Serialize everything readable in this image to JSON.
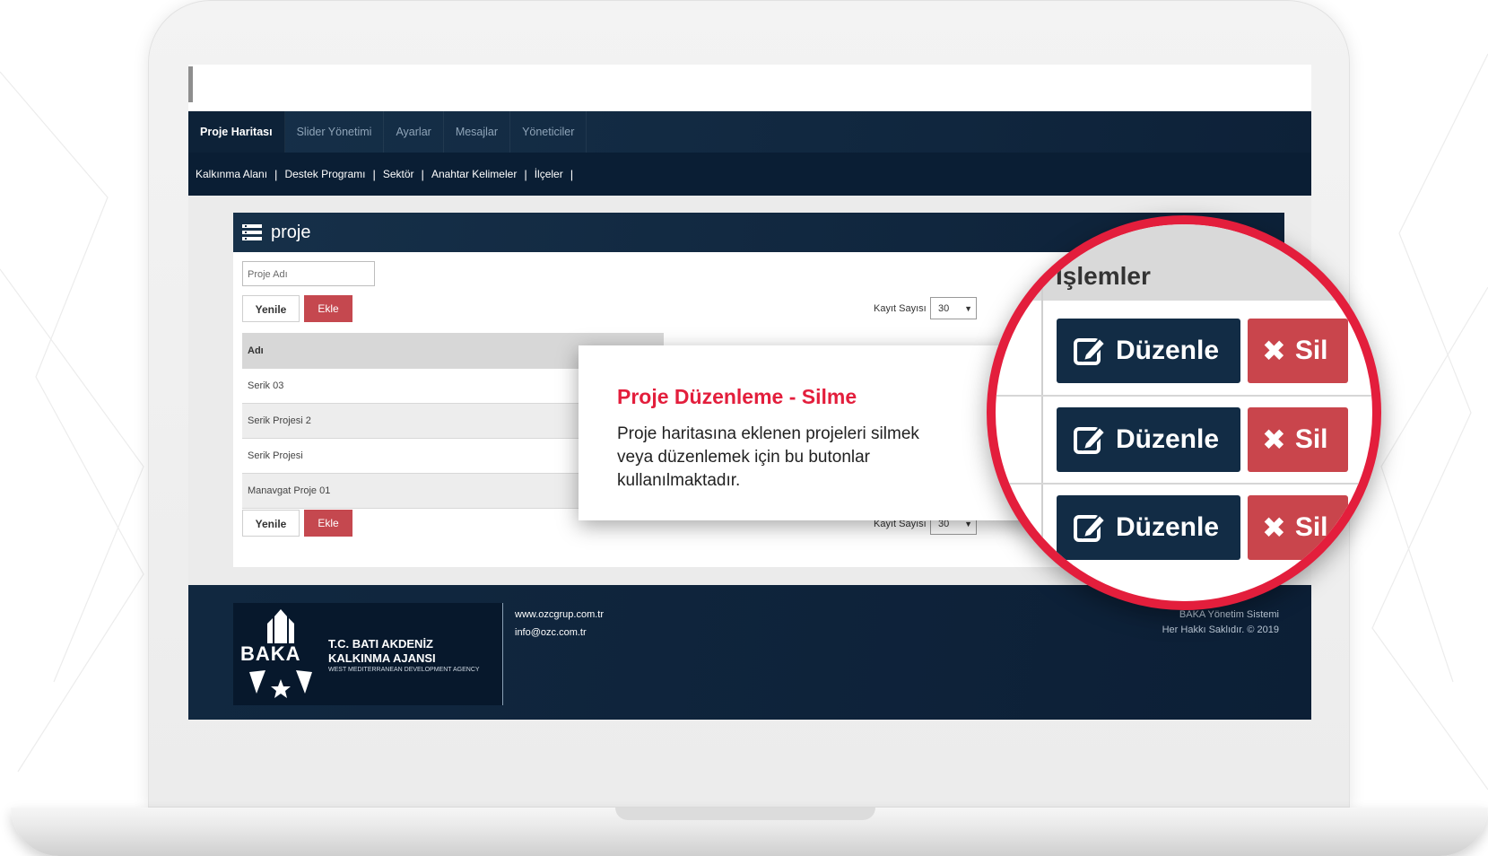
{
  "nav": {
    "tabs": [
      {
        "label": "Proje Haritası",
        "active": true
      },
      {
        "label": "Slider Yönetimi",
        "active": false
      },
      {
        "label": "Ayarlar",
        "active": false
      },
      {
        "label": "Mesajlar",
        "active": false
      },
      {
        "label": "Yöneticiler",
        "active": false
      }
    ],
    "subnav": [
      "Kalkınma Alanı",
      "Destek Programı",
      "Sektör",
      "Anahtar Kelimeler",
      "İlçeler"
    ],
    "separator": "|"
  },
  "panel": {
    "title": "proje",
    "search_placeholder": "Proje Adı",
    "refresh_label": "Yenile",
    "add_label": "Ekle",
    "record_count_label": "Kayıt Sayısı",
    "record_count_value": "30"
  },
  "table": {
    "header": "Adı",
    "rows": [
      "Serik 03",
      "Serik Projesi 2",
      "Serik Projesi",
      "Manavgat Proje 01"
    ]
  },
  "footer": {
    "website": "www.ozcgrup.com.tr",
    "email": "info@ozc.com.tr",
    "system_name": "BAKA Yönetim Sistemi",
    "copyright": "Her Hakkı Saklıdır. © 2019",
    "logo": {
      "short": "BAKA",
      "line1": "T.C. BATI AKDENİZ",
      "line2": "KALKINMA AJANSI",
      "line3": "WEST MEDITERRANEAN DEVELOPMENT AGENCY"
    }
  },
  "callout": {
    "title": "Proje Düzenleme - Silme",
    "description": "Proje haritasına eklenen projeleri silmek veya düzenlemek için bu butonlar kullanılmaktadır."
  },
  "magnifier": {
    "header": "İşlemler",
    "edit_label": "Düzenle",
    "delete_label": "Sil"
  },
  "colors": {
    "navy": "#122c45",
    "delete_red": "#c9454c",
    "accent_red": "#e31e3c"
  }
}
